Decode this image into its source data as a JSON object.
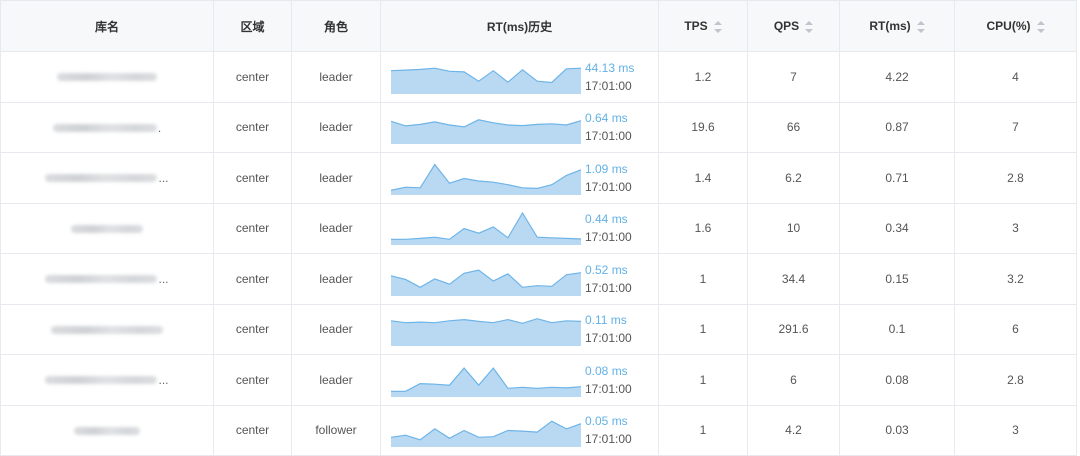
{
  "columns": {
    "name": "库名",
    "region": "区域",
    "role": "角色",
    "rt_history": "RT(ms)历史",
    "tps": "TPS",
    "qps": "QPS",
    "rt": "RT(ms)",
    "cpu": "CPU(%)"
  },
  "colors": {
    "sparkline_fill": "#b9d9f2",
    "sparkline_stroke": "#6db4e8",
    "sparkline_value": "#62b1e6"
  },
  "rows": [
    {
      "name_ellipsis": "",
      "region": "center",
      "role": "leader",
      "rt_latest": "44.13 ms",
      "rt_time": "17:01:00",
      "rt_series": [
        0.72,
        0.74,
        0.76,
        0.8,
        0.7,
        0.68,
        0.38,
        0.72,
        0.35,
        0.75,
        0.38,
        0.34,
        0.78,
        0.8
      ],
      "tps": "1.2",
      "qps": "7",
      "rt": "4.22",
      "cpu": "4"
    },
    {
      "name_ellipsis": ".",
      "region": "center",
      "role": "leader",
      "rt_latest": "0.64 ms",
      "rt_time": "17:01:00",
      "rt_series": [
        0.7,
        0.55,
        0.6,
        0.68,
        0.58,
        0.52,
        0.75,
        0.65,
        0.58,
        0.56,
        0.6,
        0.62,
        0.58,
        0.72
      ],
      "tps": "19.6",
      "qps": "66",
      "rt": "0.87",
      "cpu": "7"
    },
    {
      "name_ellipsis": "...",
      "region": "center",
      "role": "leader",
      "rt_latest": "1.09 ms",
      "rt_time": "17:01:00",
      "rt_series": [
        0.12,
        0.22,
        0.2,
        0.95,
        0.35,
        0.5,
        0.42,
        0.38,
        0.3,
        0.2,
        0.18,
        0.3,
        0.6,
        0.78
      ],
      "tps": "1.4",
      "qps": "6.2",
      "rt": "0.71",
      "cpu": "2.8"
    },
    {
      "name_ellipsis": "",
      "region": "center",
      "role": "leader",
      "rt_latest": "0.44 ms",
      "rt_time": "17:01:00",
      "rt_series": [
        0.15,
        0.15,
        0.18,
        0.22,
        0.15,
        0.5,
        0.35,
        0.55,
        0.2,
        1.0,
        0.22,
        0.2,
        0.18,
        0.16
      ],
      "tps": "1.6",
      "qps": "10",
      "rt": "0.34",
      "cpu": "3"
    },
    {
      "name_ellipsis": "...",
      "region": "center",
      "role": "leader",
      "rt_latest": "0.52 ms",
      "rt_time": "17:01:00",
      "rt_series": [
        0.62,
        0.5,
        0.25,
        0.52,
        0.35,
        0.7,
        0.8,
        0.45,
        0.68,
        0.25,
        0.3,
        0.28,
        0.65,
        0.72
      ],
      "tps": "1",
      "qps": "34.4",
      "rt": "0.15",
      "cpu": "3.2"
    },
    {
      "name_ellipsis": "",
      "region": "center",
      "role": "leader",
      "rt_latest": "0.11 ms",
      "rt_time": "17:01:00",
      "rt_series": [
        0.78,
        0.72,
        0.74,
        0.72,
        0.78,
        0.82,
        0.76,
        0.72,
        0.82,
        0.7,
        0.85,
        0.72,
        0.78,
        0.76
      ],
      "tps": "1",
      "qps": "291.6",
      "rt": "0.1",
      "cpu": "6"
    },
    {
      "name_ellipsis": "...",
      "region": "center",
      "role": "leader",
      "rt_latest": "0.08 ms",
      "rt_time": "17:01:00",
      "rt_series": [
        0.15,
        0.15,
        0.4,
        0.38,
        0.35,
        0.9,
        0.35,
        0.9,
        0.25,
        0.28,
        0.25,
        0.28,
        0.26,
        0.3
      ],
      "tps": "1",
      "qps": "6",
      "rt": "0.08",
      "cpu": "2.8"
    },
    {
      "name_ellipsis": "",
      "region": "center",
      "role": "follower",
      "rt_latest": "0.05 ms",
      "rt_time": "17:01:00",
      "rt_series": [
        0.28,
        0.35,
        0.2,
        0.55,
        0.25,
        0.5,
        0.28,
        0.3,
        0.5,
        0.48,
        0.45,
        0.8,
        0.55,
        0.72
      ],
      "tps": "1",
      "qps": "4.2",
      "rt": "0.03",
      "cpu": "3"
    }
  ]
}
